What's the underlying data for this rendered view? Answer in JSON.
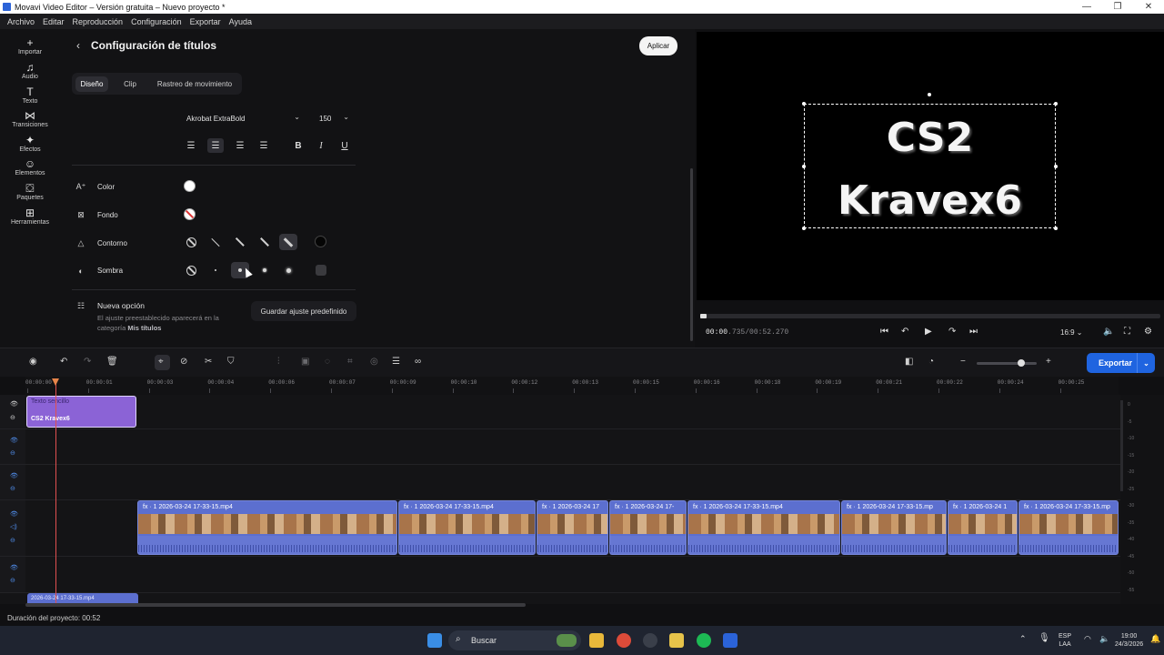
{
  "window": {
    "title": "Movavi Video Editor – Versión gratuita – Nuevo proyecto *",
    "controls": [
      "—",
      "❐",
      "✕"
    ]
  },
  "menu": [
    "Archivo",
    "Editar",
    "Reproducción",
    "Configuración",
    "Exportar",
    "Ayuda"
  ],
  "rail": [
    {
      "icon": "plus-icon",
      "glyph": "+",
      "label": "Importar"
    },
    {
      "icon": "music-icon",
      "glyph": "♫",
      "label": "Audio"
    },
    {
      "icon": "text-icon",
      "glyph": "T",
      "label": "Texto"
    },
    {
      "icon": "transitions-icon",
      "glyph": "⋈",
      "label": "Transiciones"
    },
    {
      "icon": "effects-icon",
      "glyph": "✦",
      "label": "Efectos"
    },
    {
      "icon": "elements-icon",
      "glyph": "☺",
      "label": "Elementos"
    },
    {
      "icon": "packages-icon",
      "glyph": "⛋",
      "label": "Paquetes"
    },
    {
      "icon": "tools-icon",
      "glyph": "⊞",
      "label": "Herramientas"
    }
  ],
  "panel": {
    "title": "Configuración de títulos",
    "apply": "Aplicar",
    "tabs": [
      "Diseño",
      "Clip",
      "Rastreo de movimiento"
    ],
    "font": "Akrobat ExtraBold",
    "size": "150",
    "format": {
      "bold": "B",
      "italic": "I",
      "underline": "U"
    },
    "props": {
      "color": "Color",
      "background": "Fondo",
      "outline": "Contorno",
      "shadow": "Sombra"
    },
    "preset": {
      "title": "Nueva opción",
      "desc_before": "El ajuste preestablecido aparecerá en la categoría ",
      "desc_bold": "Mis títulos",
      "save": "Guardar ajuste predefinido"
    }
  },
  "preview": {
    "line1": "CS2",
    "line2": "Kravex6",
    "time_current": "00:00",
    "time_ms": ".735",
    "time_total": "/00:52.270",
    "aspect": "16:9"
  },
  "toolbar": {
    "export": "Exportar"
  },
  "ruler": [
    "00:00:00",
    "00:00:01",
    "00:00:03",
    "00:00:04",
    "00:00:06",
    "00:00:07",
    "00:00:09",
    "00:00:10",
    "00:00:12",
    "00:00:13",
    "00:00:15",
    "00:00:16",
    "00:00:18",
    "00:00:19",
    "00:00:21",
    "00:00:22",
    "00:00:24",
    "00:00:25"
  ],
  "timeline": {
    "title_clip": {
      "style": "Texto sencillo",
      "text": "CS2 Kravex6"
    },
    "video_clips": [
      "fx · 1   2026-03-24 17-33-15.mp4",
      "fx · 1   2026-03-24 17-33-15.mp4",
      "fx · 1   2026-03-24 17",
      "fx · 1   2026-03-24 17-",
      "fx · 1   2026-03-24 17-33-15.mp4",
      "fx · 1   2026-03-24 17-33-15.mp",
      "fx · 1   2026-03-24 1",
      "fx · 1   2026-03-24 17-33-15.mp"
    ],
    "bottom_clip": "2026-03-24 17-33-15.mp4",
    "meter_labels": [
      "0",
      "-5",
      "-10",
      "-15",
      "-20",
      "-25",
      "-30",
      "-35",
      "-40",
      "-45",
      "-50",
      "-55"
    ]
  },
  "status": {
    "duration": "Duración del proyecto: 00:52"
  },
  "taskbar": {
    "search": "Buscar",
    "lang_top": "ESP",
    "lang_bottom": "LAA",
    "time": "19:00",
    "date": "24/3/2026"
  },
  "colors": {
    "accent": "#1f64e0",
    "title_clip": "#8b63d6",
    "video_clip": "#5c6fcf",
    "playhead": "#e05050"
  }
}
